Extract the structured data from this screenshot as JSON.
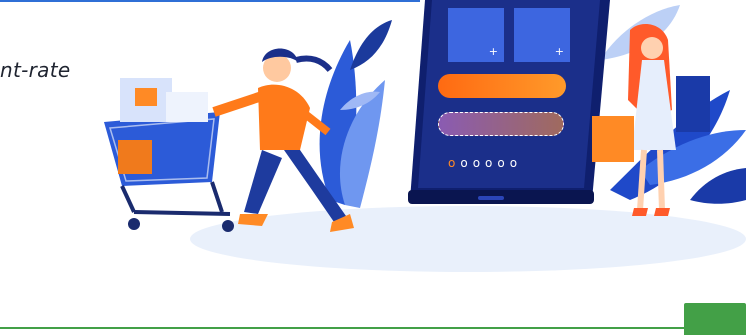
{
  "headline": "nt-rate",
  "colors": {
    "top_rule": "#2f6fd6",
    "bottom_rule": "#43a047",
    "green_tab": "#43a047",
    "phone_body": "#1b2f8a",
    "accent_orange": "#ff7a1a"
  },
  "phone": {
    "tiles": [
      "+",
      "+"
    ],
    "pagination": [
      "o",
      "o",
      "o",
      "o",
      "o",
      "o"
    ]
  }
}
